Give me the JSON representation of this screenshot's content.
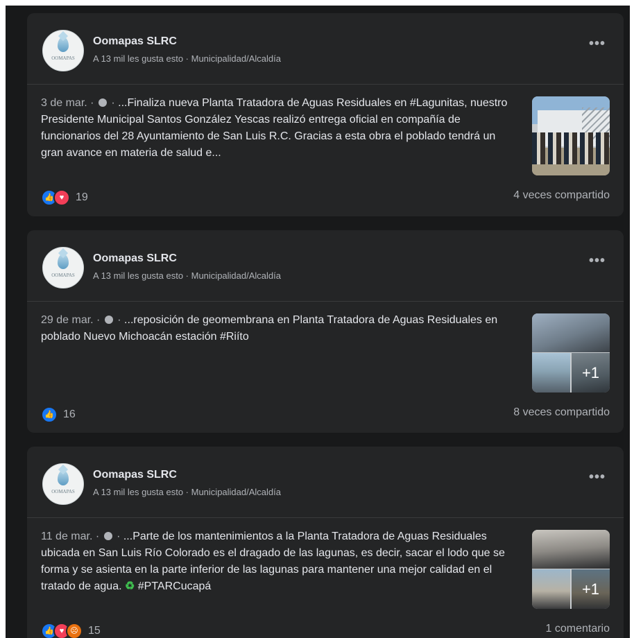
{
  "posts": [
    {
      "page_name": "Oomapas SLRC",
      "page_meta": "A 13 mil les gusta esto · Municipalidad/Alcaldía",
      "avatar_text": "OOMAPAS",
      "date": "3 de mar. · ",
      "sep": " · ",
      "body": "...Finaliza nueva Planta Tratadora de Aguas Residuales en #Lagunitas, nuestro Presidente Municipal Santos González Yescas realizó entrega oficial en compañía de funcionarios del 28 Ayuntamiento de San Luis R.C. Gracias a esta obra el poblado tendrá un gran avance en materia de salud e...",
      "reaction_icons": [
        "like-icon",
        "love-icon"
      ],
      "reaction_count": "19",
      "shares": "4 veces compartido"
    },
    {
      "page_name": "Oomapas SLRC",
      "page_meta": "A 13 mil les gusta esto · Municipalidad/Alcaldía",
      "avatar_text": "OOMAPAS",
      "date": "29 de mar. · ",
      "sep": " · ",
      "body": "...reposición de geomembrana en Planta Tratadora de Aguas Residuales en poblado Nuevo Michoacán estación #Riíto",
      "photo_more": "+1",
      "reaction_icons": [
        "like-icon"
      ],
      "reaction_count": "16",
      "shares": "8 veces compartido"
    },
    {
      "page_name": "Oomapas SLRC",
      "page_meta": "A 13 mil les gusta esto · Municipalidad/Alcaldía",
      "avatar_text": "OOMAPAS",
      "date": "11 de mar. · ",
      "sep": " · ",
      "body": "...Parte de los mantenimientos a la Planta Tratadora de Aguas Residuales ubicada en San Luis Río Colorado es el dragado de las lagunas, es decir, sacar el lodo que se forma y se asienta en la parte inferior de las lagunas para mantener una mejor calidad en el tratado de agua. ",
      "emoji": "♻",
      "hashtag": " #PTARCucapá",
      "photo_more": "+1",
      "reaction_icons": [
        "like-icon",
        "love-icon",
        "angry-icon"
      ],
      "reaction_count": "15",
      "shares": "1 comentario"
    }
  ],
  "more_label": "•••",
  "colors": {
    "background": "#18191a",
    "card": "#242526",
    "text": "#e4e6eb",
    "secondary": "#b0b3b8",
    "like": "#1877f2",
    "love": "#f33e58",
    "angry": "#e9710f"
  }
}
